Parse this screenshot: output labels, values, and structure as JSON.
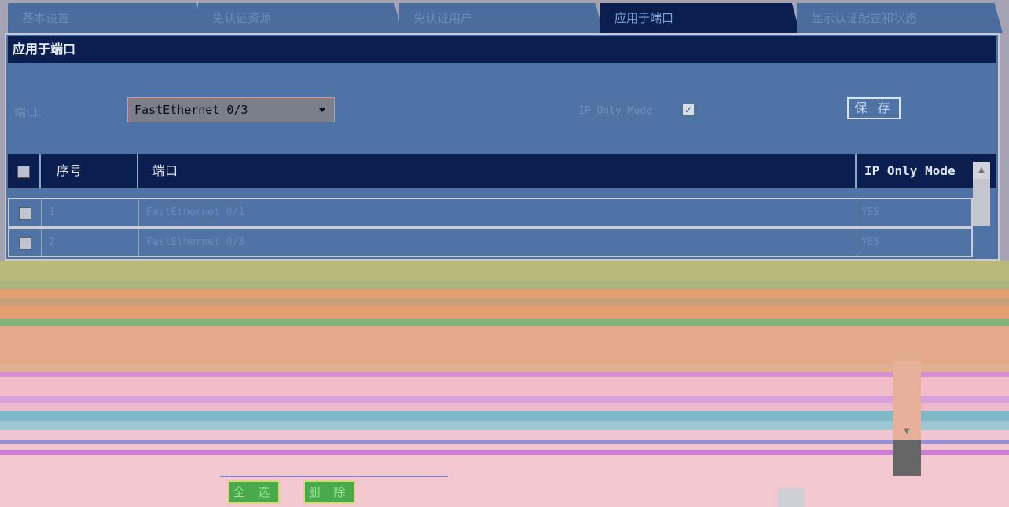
{
  "tabs": [
    {
      "label": "基本设置"
    },
    {
      "label": "免认证资源"
    },
    {
      "label": "免认证用户"
    },
    {
      "label": "应用于端口"
    },
    {
      "label": "显示认证配置和状态"
    }
  ],
  "panel": {
    "title": "应用于端口",
    "port_label": "端口:",
    "port_value": "FastEthernet 0/3",
    "iponly_label": "IP Only Mode",
    "iponly_checked": true,
    "save_label": "保 存"
  },
  "table": {
    "headers": [
      "序号",
      "端口",
      "IP Only Mode"
    ],
    "rows": [
      {
        "index": "1",
        "port": "FastEthernet 0/1",
        "mode": "YES"
      },
      {
        "index": "2",
        "port": "FastEthernet 0/3",
        "mode": "YES"
      }
    ]
  },
  "footer": {
    "select_all_label": "全 选",
    "delete_label": "删 除"
  },
  "colors": {
    "header_bg": "#0a1f4f",
    "panel_bg": "#4f73a5",
    "button_green": "#4aa94a"
  }
}
